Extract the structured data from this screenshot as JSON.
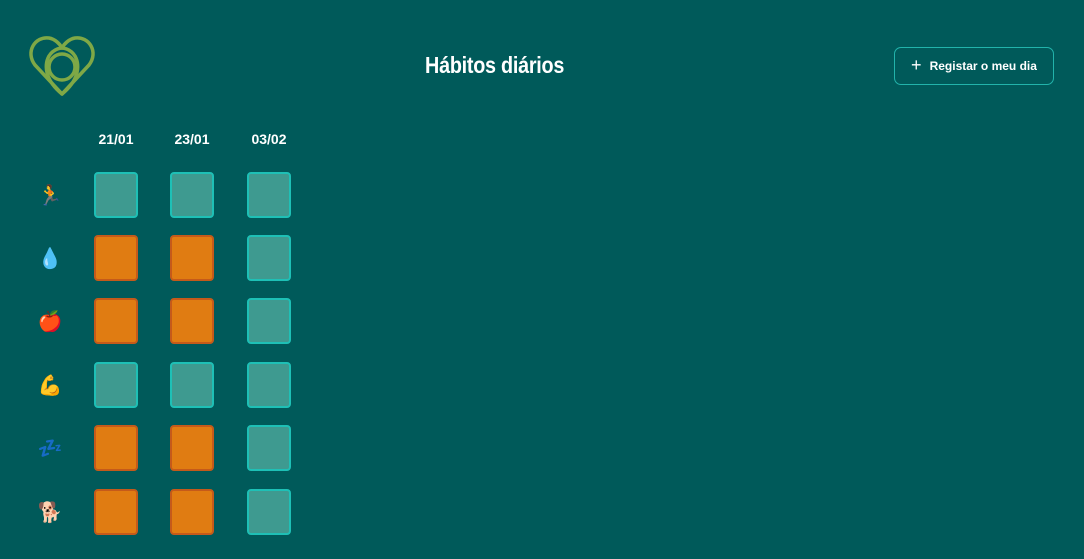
{
  "header": {
    "title": "Hábitos diários",
    "register_button_label": "Registar o meu dia",
    "register_button_icon": "plus-icon"
  },
  "logo": {
    "icon": "heart-logo-icon",
    "color": "#7fa846"
  },
  "colors": {
    "background": "#005a5a",
    "done": "#e07c12",
    "not_done": "#3e9a90",
    "not_done_border": "#1ec0b6"
  },
  "dates": [
    "21/01",
    "23/01",
    "03/02"
  ],
  "habits": [
    {
      "icon": "running-person-icon",
      "glyph": "🏃",
      "days": [
        false,
        false,
        false
      ]
    },
    {
      "icon": "water-drop-icon",
      "glyph": "💧",
      "days": [
        true,
        true,
        false
      ]
    },
    {
      "icon": "apple-icon",
      "glyph": "🍎",
      "days": [
        true,
        true,
        false
      ]
    },
    {
      "icon": "flexed-biceps-icon",
      "glyph": "💪",
      "days": [
        false,
        false,
        false
      ]
    },
    {
      "icon": "sleep-zzz-icon",
      "glyph": "💤",
      "days": [
        true,
        true,
        false
      ]
    },
    {
      "icon": "guide-dog-icon",
      "glyph": "🐕",
      "days": [
        true,
        true,
        false
      ]
    }
  ]
}
